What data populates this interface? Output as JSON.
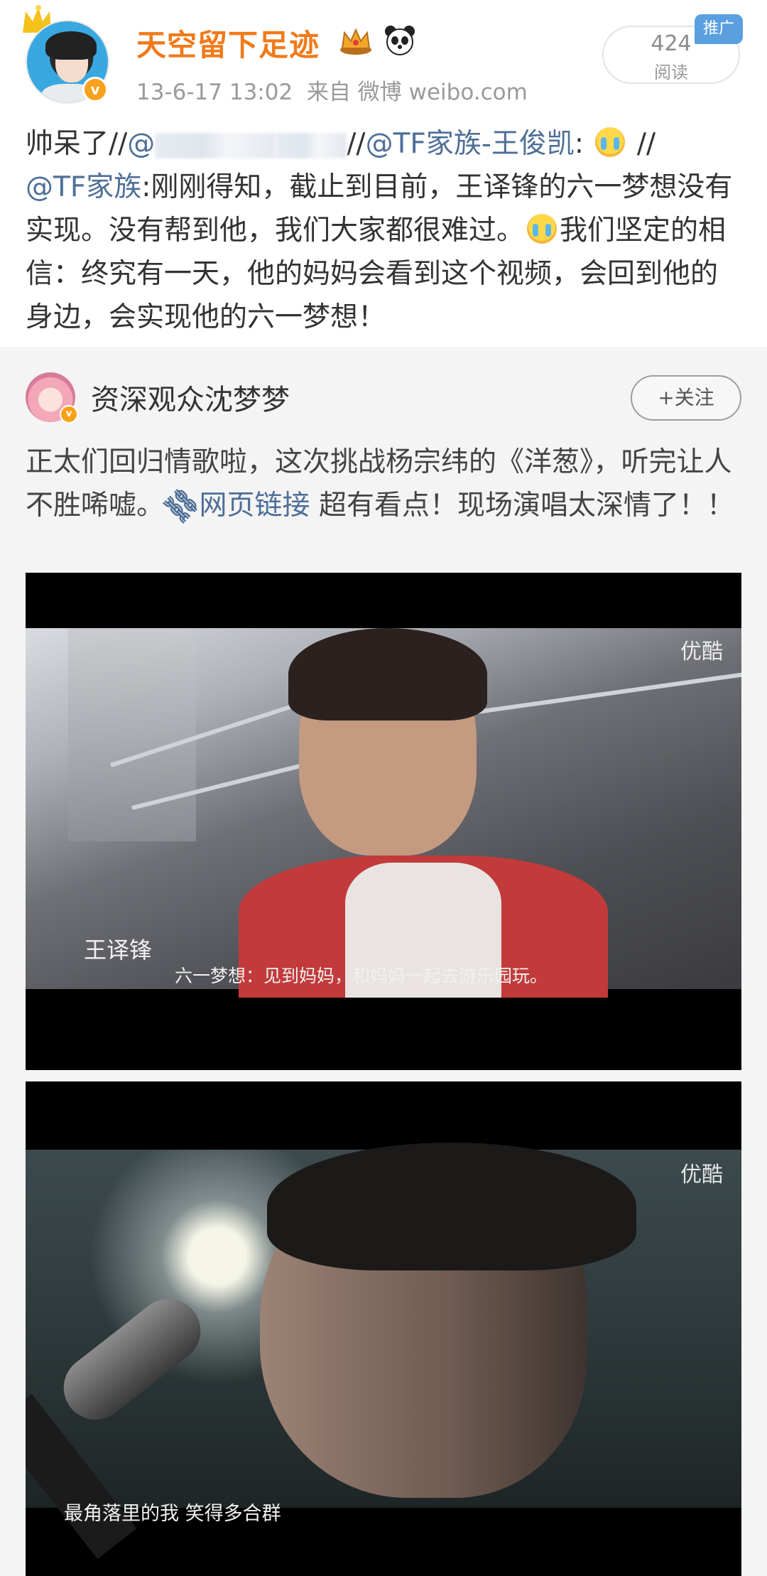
{
  "post": {
    "username": "天空留下足迹",
    "timestamp": "13-6-17 13:02",
    "source": "来自 微博 weibo.com",
    "read_count": "424",
    "read_label": "阅读",
    "promo_tag": "推广",
    "text_1": "帅呆了//",
    "mention_blurred": "@",
    "sep": "//",
    "mention_1": "@TF家族-王俊凯",
    "colon": ": ",
    "sep_2": " //",
    "mention_2": "@TF家族",
    "text_2": ":刚刚得知，截止到目前，王译锋的六一梦想没有实现。没有帮到他，我们大家都很难过。",
    "text_3": "我们坚定的相信：终究有一天，他的妈妈会看到这个视频，会回到他的身边，会实现他的六一梦想！"
  },
  "repost": {
    "username": "资深观众沈梦梦",
    "follow_label": "+关注",
    "text_1": "正太们回归情歌啦，这次挑战杨宗纬的《洋葱》，听完让人不胜唏嘘。",
    "link_icon": "🔗",
    "link_text": "网页链接",
    "text_2": " 超有看点！现场演唱太深情了！！"
  },
  "frames": [
    {
      "watermark": "优酷",
      "subtitle_name": "王译锋",
      "subtitle_text": "六一梦想：见到妈妈，和妈妈一起去游乐园玩。"
    },
    {
      "watermark": "优酷",
      "subtitle_text": "最角落里的我  笑得多合群"
    }
  ],
  "icons": {
    "crown": "crown-icon",
    "panda": "panda-icon",
    "verified": "verified-v-icon",
    "emoji": "crying-emoji-icon",
    "link": "link-icon"
  },
  "colors": {
    "username": "#f07a1a",
    "link": "#4e6f98",
    "promo": "#5aa0e0",
    "verified": "#f7a21a"
  }
}
